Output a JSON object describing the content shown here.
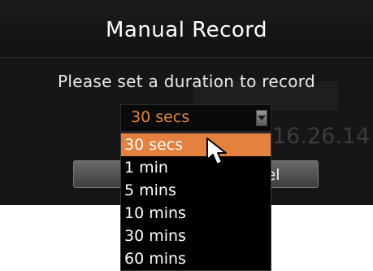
{
  "dialog": {
    "title": "Manual Record",
    "prompt": "Please set a duration to record"
  },
  "duration_select": {
    "selected_value": "30 secs",
    "options": [
      "30 secs",
      "1 min",
      "5 mins",
      "10 mins",
      "30 mins",
      "60 mins"
    ],
    "highlighted_index": 0,
    "accent_color": "#e4813e"
  },
  "buttons": {
    "cancel_partial": "el"
  },
  "background": {
    "timestamp_fragment": "16.26.14"
  },
  "icons": {
    "dropdown_arrow": "chevron-down-icon",
    "pointer": "mouse-pointer-icon"
  }
}
